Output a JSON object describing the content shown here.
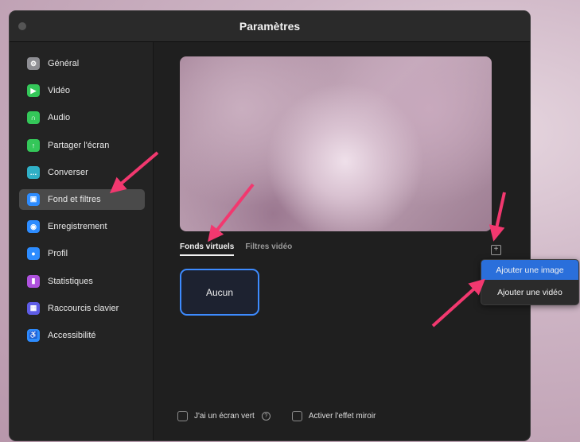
{
  "window": {
    "title": "Paramètres"
  },
  "sidebar": {
    "items": [
      {
        "label": "Général",
        "icon": "gear-icon",
        "color": "#8e8e93",
        "glyph": "⚙"
      },
      {
        "label": "Vidéo",
        "icon": "video-camera-icon",
        "color": "#34c759",
        "glyph": "▶"
      },
      {
        "label": "Audio",
        "icon": "headphones-icon",
        "color": "#34c759",
        "glyph": "∩"
      },
      {
        "label": "Partager l'écran",
        "icon": "share-screen-icon",
        "color": "#34c759",
        "glyph": "↑"
      },
      {
        "label": "Converser",
        "icon": "chat-icon",
        "color": "#30b0c7",
        "glyph": "…"
      },
      {
        "label": "Fond et filtres",
        "icon": "background-icon",
        "color": "#2d8cff",
        "glyph": "▣",
        "active": true
      },
      {
        "label": "Enregistrement",
        "icon": "record-icon",
        "color": "#2d8cff",
        "glyph": "◉"
      },
      {
        "label": "Profil",
        "icon": "profile-icon",
        "color": "#2d8cff",
        "glyph": "●"
      },
      {
        "label": "Statistiques",
        "icon": "statistics-icon",
        "color": "#af52de",
        "glyph": "▮"
      },
      {
        "label": "Raccourcis clavier",
        "icon": "keyboard-icon",
        "color": "#5e5ce6",
        "glyph": "▦"
      },
      {
        "label": "Accessibilité",
        "icon": "accessibility-icon",
        "color": "#2d8cff",
        "glyph": "♿"
      }
    ]
  },
  "main": {
    "tabs": [
      {
        "label": "Fonds virtuels",
        "active": true
      },
      {
        "label": "Filtres vidéo",
        "active": false
      }
    ],
    "add_symbol": "+",
    "background_none_label": "Aucun",
    "green_screen_label": "J'ai un écran vert",
    "help_symbol": "?",
    "mirror_label": "Activer l'effet miroir"
  },
  "dropdown": {
    "items": [
      {
        "label": "Ajouter une image",
        "selected": true
      },
      {
        "label": "Ajouter une vidéo",
        "selected": false
      }
    ]
  },
  "colors": {
    "accent": "#2d8cff",
    "arrow": "#f2386f"
  }
}
